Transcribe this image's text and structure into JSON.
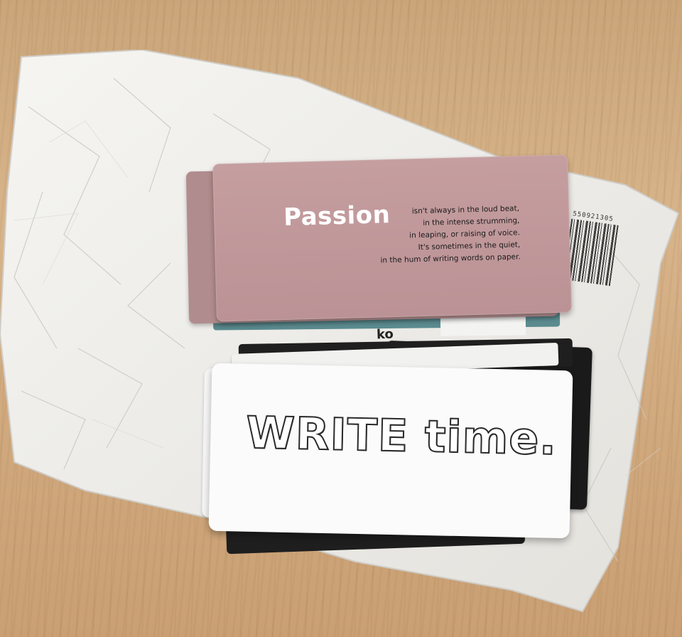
{
  "scene": {
    "description_colors": {
      "wood": "#d2ab80",
      "envelope": "#f2f0ec",
      "pink_card": "#c29a9c",
      "teal_edge": "#5b8b8f",
      "black_card": "#1a1a1a",
      "white_card": "#fbfbfb"
    }
  },
  "pink_card": {
    "title": "Passion",
    "lines": [
      "isn't always in the loud beat,",
      "in the intense strumming,",
      "in leaping, or raising of voice.",
      "It's sometimes in the quiet,",
      "in the hum of writing words on paper."
    ]
  },
  "middle_label": "ko",
  "white_card": {
    "title": "WRITE time."
  },
  "barcode": {
    "digits": "550921305"
  }
}
